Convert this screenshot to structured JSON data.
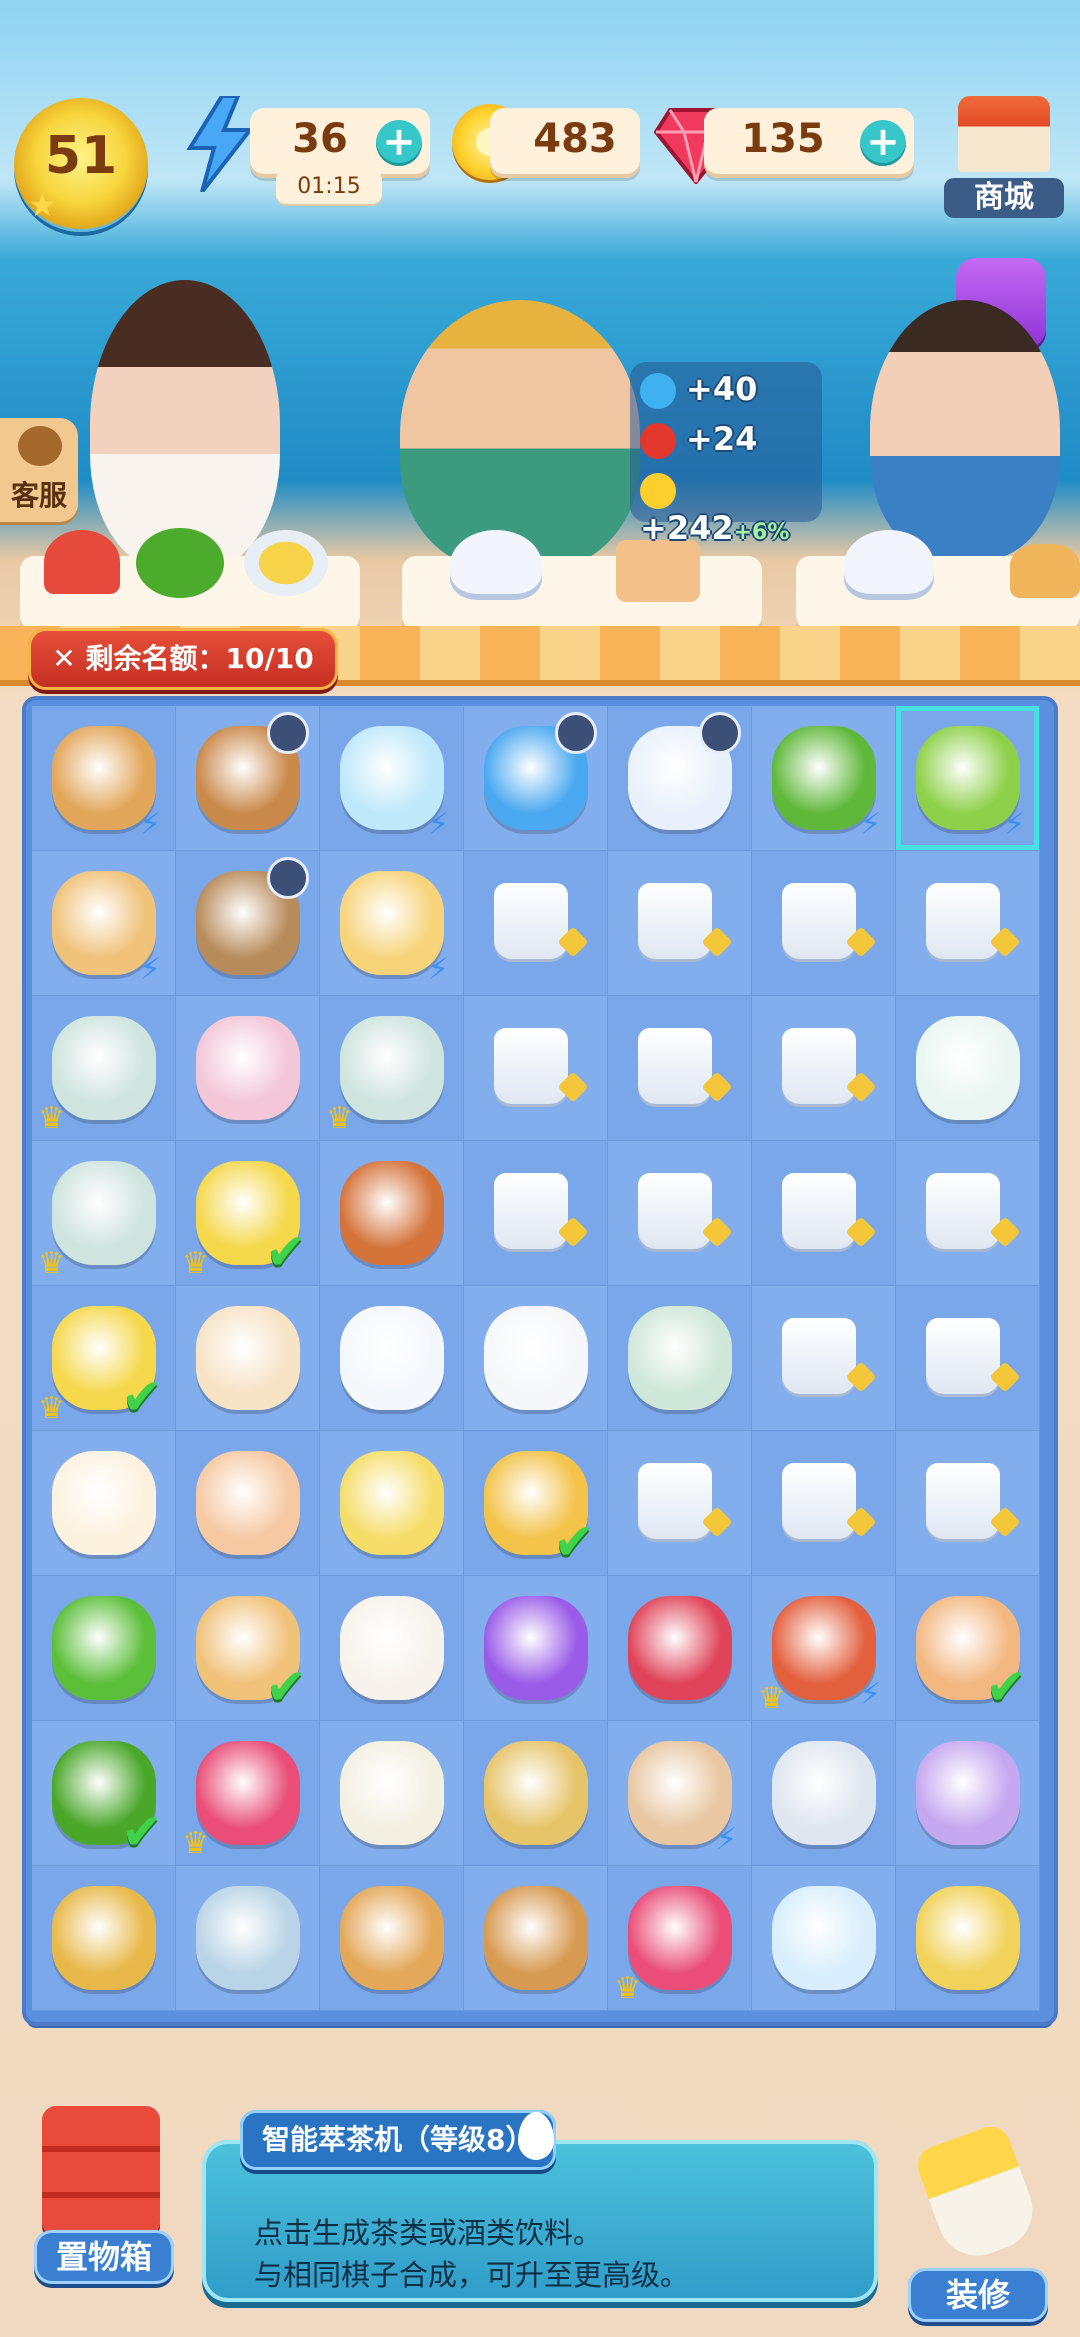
{
  "hud": {
    "level": "51",
    "energy": {
      "value": "36",
      "timer": "01:15"
    },
    "coins": "483",
    "gems": "135",
    "shop_label": "商城"
  },
  "support_label": "客服",
  "quota": "剩余名额：10/10",
  "rewards": [
    {
      "icon": "energy-potion-icon",
      "text": "+40"
    },
    {
      "icon": "lantern-icon",
      "text": "+24"
    },
    {
      "icon": "coin-icon",
      "text": "+242",
      "bonus": "+6%"
    }
  ],
  "board": {
    "rows": [
      [
        {
          "id": "clay-pot",
          "bolt": true
        },
        {
          "id": "cherry-basket",
          "timer": true
        },
        {
          "id": "duck-fishbowl",
          "bolt": true
        },
        {
          "id": "blue-fridge",
          "timer": true
        },
        {
          "id": "ice-cabinet",
          "timer": true
        },
        {
          "id": "vegetable-basket",
          "bolt": true
        },
        {
          "id": "tea-machine",
          "selected": true,
          "bolt": true
        }
      ],
      [
        {
          "id": "soup-pot",
          "bolt": true
        },
        {
          "id": "cherry-bucket",
          "timer": true
        },
        {
          "id": "water-bucket",
          "bolt": true
        },
        {
          "id": "tea-bag"
        },
        {
          "id": "tea-bag"
        },
        {
          "id": "tea-bag"
        },
        {
          "id": "tea-bag"
        }
      ],
      [
        {
          "id": "sake-set",
          "crown": true
        },
        {
          "id": "dessert-bowl"
        },
        {
          "id": "sake-set",
          "crown": true
        },
        {
          "id": "tea-bag"
        },
        {
          "id": "tea-bag"
        },
        {
          "id": "tea-bag"
        },
        {
          "id": "porcelain-cup"
        }
      ],
      [
        {
          "id": "sake-set",
          "crown": true
        },
        {
          "id": "corn-soup",
          "crown": true,
          "check": true
        },
        {
          "id": "lemon-tea"
        },
        {
          "id": "tea-bag"
        },
        {
          "id": "tea-bag"
        },
        {
          "id": "tea-bag"
        },
        {
          "id": "tea-bag"
        }
      ],
      [
        {
          "id": "corn-soup",
          "crown": true,
          "check": true
        },
        {
          "id": "steamed-bun"
        },
        {
          "id": "teapot"
        },
        {
          "id": "lidded-bowl"
        },
        {
          "id": "vase"
        },
        {
          "id": "tea-bag"
        },
        {
          "id": "tea-bag"
        }
      ],
      [
        {
          "id": "ice-cream"
        },
        {
          "id": "popsicle"
        },
        {
          "id": "egg-custard"
        },
        {
          "id": "egg-soup",
          "check": true
        },
        {
          "id": "tea-bag"
        },
        {
          "id": "tea-bag"
        },
        {
          "id": "tea-bag"
        }
      ],
      [
        {
          "id": "green-onion"
        },
        {
          "id": "taco",
          "check": true
        },
        {
          "id": "takeout-box"
        },
        {
          "id": "purple-bubble"
        },
        {
          "id": "red-bubble"
        },
        {
          "id": "seafood-platter",
          "crown": true,
          "bolt": true
        },
        {
          "id": "fried-rice",
          "check": true
        }
      ],
      [
        {
          "id": "broccoli",
          "check": true
        },
        {
          "id": "dragon-fruit",
          "crown": true
        },
        {
          "id": "juicer"
        },
        {
          "id": "fishing-rod"
        },
        {
          "id": "shopping-bag",
          "bolt": true
        },
        {
          "id": "flower-plate"
        },
        {
          "id": "crystal"
        }
      ],
      [
        {
          "id": "grinder"
        },
        {
          "id": "porcelain-bowl"
        },
        {
          "id": "spatula"
        },
        {
          "id": "slotted-spatula"
        },
        {
          "id": "dragon-fruit",
          "crown": true
        },
        {
          "id": "ice-cubes"
        },
        {
          "id": "strainer"
        }
      ]
    ]
  },
  "storage_label": "置物箱",
  "decorate_label": "装修",
  "info": {
    "title": "智能萃茶机（等级8）",
    "line1": "点击生成茶类或酒类饮料。",
    "line2": "与相同棋子合成，可升至更高级。"
  }
}
